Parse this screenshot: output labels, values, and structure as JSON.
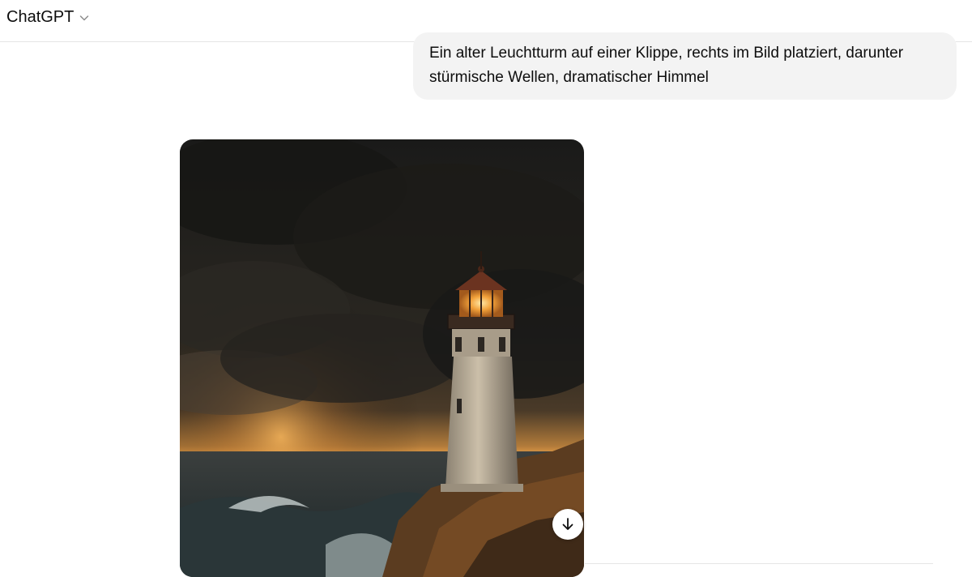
{
  "header": {
    "model_name": "ChatGPT",
    "dropdown_icon": "chevron-down-icon"
  },
  "conversation": {
    "user_message": "Ein alter Leuchtturm auf einer Klippe, rechts im Bild platziert, darunter stürmische Wellen, dramatischer Himmel",
    "assistant_image": {
      "download_icon": "arrow-down-icon"
    }
  },
  "colors": {
    "user_bubble": "#f3f3f3",
    "border": "#e5e5e5",
    "text": "#0d0d0d"
  }
}
